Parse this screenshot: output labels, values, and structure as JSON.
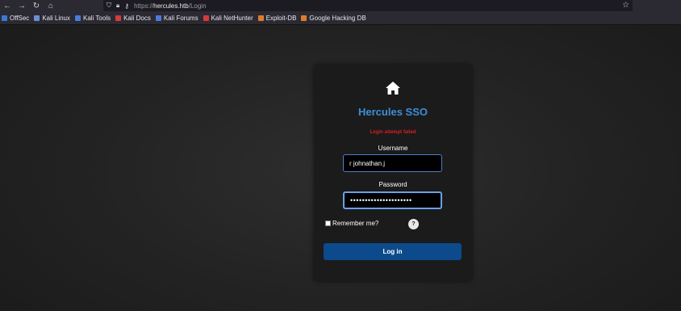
{
  "browser": {
    "url_scheme": "https://",
    "url_host": "hercules.htb",
    "url_path": "/Login",
    "bookmarks": [
      {
        "label": "OffSec",
        "icon": "offsec-icon",
        "color": "#3a79d8"
      },
      {
        "label": "Kali Linux",
        "icon": "kali-icon",
        "color": "#6b8fd6"
      },
      {
        "label": "Kali Tools",
        "icon": "kali-tools-icon",
        "color": "#4b7bd8"
      },
      {
        "label": "Kali Docs",
        "icon": "kali-docs-icon",
        "color": "#d73a3a"
      },
      {
        "label": "Kali Forums",
        "icon": "kali-forums-icon",
        "color": "#4b7bd8"
      },
      {
        "label": "Kali NetHunter",
        "icon": "nethunter-icon",
        "color": "#d73a3a"
      },
      {
        "label": "Exploit-DB",
        "icon": "exploit-db-icon",
        "color": "#e07a2e"
      },
      {
        "label": "Google Hacking DB",
        "icon": "ghdb-icon",
        "color": "#e07a2e"
      }
    ]
  },
  "login": {
    "title": "Hercules SSO",
    "error": "Login attempt failed",
    "username_label": "Username",
    "username_value": "r johnathan.j",
    "password_label": "Password",
    "password_value": "•••••••••••••••••••••",
    "remember_label": "Remember me?",
    "help_label": "?",
    "submit_label": "Log in"
  },
  "colors": {
    "title": "#3d8ed8",
    "error": "#d42020",
    "button": "#0c4a8c"
  }
}
